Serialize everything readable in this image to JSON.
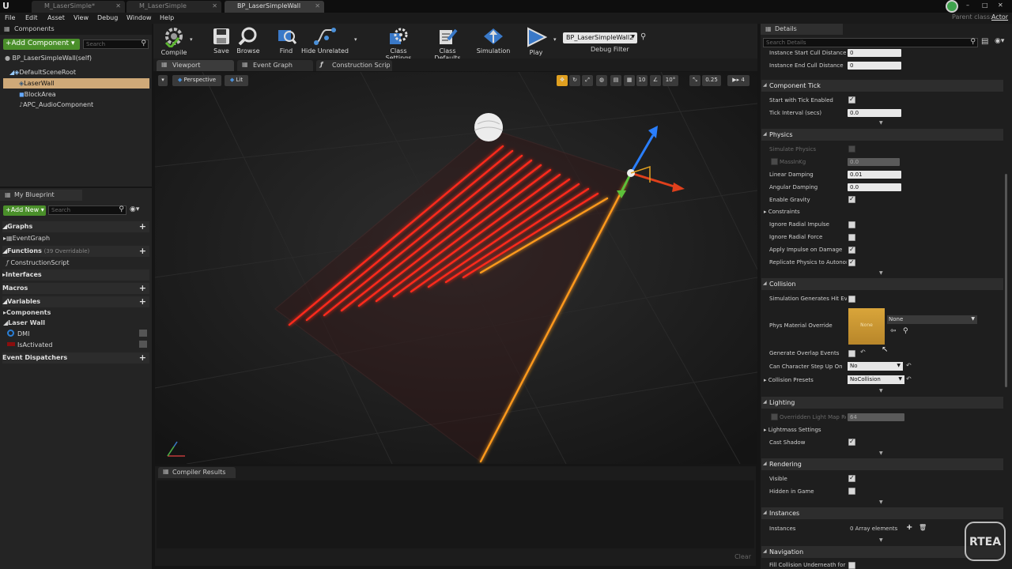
{
  "doc_tabs": [
    {
      "label": "M_LaserSimple*"
    },
    {
      "label": "M_LaserSimple"
    },
    {
      "label": "BP_LaserSimpleWall"
    }
  ],
  "parent_class": {
    "label": "Parent class:",
    "value": "Actor"
  },
  "menu": [
    "File",
    "Edit",
    "Asset",
    "View",
    "Debug",
    "Window",
    "Help"
  ],
  "components_panel": {
    "title": "Components",
    "add_label": "+Add Component ▾",
    "search_placeholder": "Search",
    "root": "BP_LaserSimpleWall(self)",
    "items": [
      "DefaultSceneRoot",
      "LaserWall",
      "BlockArea",
      "APC_AudioComponent"
    ]
  },
  "my_blueprint": {
    "title": "My Blueprint",
    "add_label": "+Add New ▾",
    "search_placeholder": "Search",
    "graphs_label": "Graphs",
    "event_graph": "EventGraph",
    "functions_label": "Functions",
    "functions_note": "(39 Overridable)",
    "construction_script": "ConstructionScript",
    "interfaces_label": "Interfaces",
    "macros_label": "Macros",
    "variables_label": "Variables",
    "var_components": "Components",
    "var_laserwall": "Laser Wall",
    "var_dmi": "DMI",
    "var_isactivated": "IsActivated",
    "dispatchers_label": "Event Dispatchers"
  },
  "toolbar": {
    "compile": "Compile",
    "save": "Save",
    "browse": "Browse",
    "find": "Find",
    "hide_unrelated": "Hide Unrelated",
    "class_settings": "Class Settings",
    "class_defaults": "Class Defaults",
    "simulation": "Simulation",
    "play": "Play",
    "debug_object": "BP_LaserSimpleWall2",
    "debug_filter": "Debug Filter"
  },
  "view_tabs": {
    "viewport": "Viewport",
    "event_graph": "Event Graph",
    "construction": "Construction Scrip"
  },
  "viewport": {
    "perspective": "Perspective",
    "lit": "Lit",
    "grid_snap": "10",
    "rot_snap": "10°",
    "scale_snap": "0.25",
    "cam_speed": "4"
  },
  "compiler": {
    "title": "Compiler Results",
    "clear": "Clear"
  },
  "details": {
    "title": "Details",
    "search_placeholder": "Search Details",
    "inst_start_cull": {
      "label": "Instance Start Cull Distance",
      "value": "0"
    },
    "inst_end_cull": {
      "label": "Instance End Cull Distance",
      "value": "0"
    },
    "component_tick": "Component Tick",
    "start_tick": {
      "label": "Start with Tick Enabled"
    },
    "tick_interval": {
      "label": "Tick Interval (secs)",
      "value": "0.0"
    },
    "physics": "Physics",
    "simulate_physics": {
      "label": "Simulate Physics"
    },
    "mass_kg": {
      "label": "MassInKg",
      "value": "0.0"
    },
    "linear_damping": {
      "label": "Linear Damping",
      "value": "0.01"
    },
    "angular_damping": {
      "label": "Angular Damping",
      "value": "0.0"
    },
    "enable_gravity": {
      "label": "Enable Gravity"
    },
    "constraints": {
      "label": "Constraints"
    },
    "ignore_radial_impulse": {
      "label": "Ignore Radial Impulse"
    },
    "ignore_radial_force": {
      "label": "Ignore Radial Force"
    },
    "apply_impulse": {
      "label": "Apply Impulse on Damage"
    },
    "replicate_physics": {
      "label": "Replicate Physics to Autonom"
    },
    "collision": "Collision",
    "sim_hit_events": {
      "label": "Simulation Generates Hit Eve"
    },
    "phys_material": {
      "label": "Phys Material Override",
      "thumb": "None",
      "value": "None"
    },
    "overlap_events": {
      "label": "Generate Overlap Events"
    },
    "char_step": {
      "label": "Can Character Step Up On",
      "value": "No"
    },
    "collision_presets": {
      "label": "Collision Presets",
      "value": "NoCollision"
    },
    "lighting": "Lighting",
    "overridden_lightmap": {
      "label": "Overridden Light Map Re",
      "value": "64"
    },
    "lightmass": {
      "label": "Lightmass Settings"
    },
    "cast_shadow": {
      "label": "Cast Shadow"
    },
    "rendering": "Rendering",
    "visible": {
      "label": "Visible"
    },
    "hidden_in_game": {
      "label": "Hidden in Game"
    },
    "instances_sec": "Instances",
    "instances": {
      "label": "Instances",
      "value": "0 Array elements"
    },
    "navigation": "Navigation",
    "fill_collision": {
      "label": "Fill Collision Underneath for N"
    }
  },
  "watermark": "RTEA"
}
